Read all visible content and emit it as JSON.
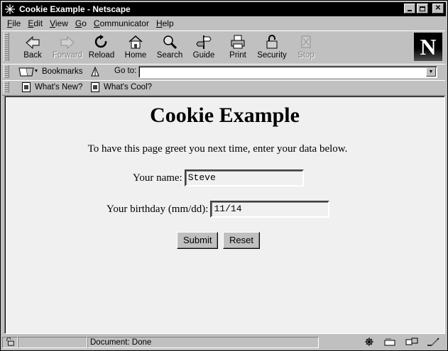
{
  "window": {
    "title": "Cookie Example - Netscape"
  },
  "menu": [
    {
      "pre": "",
      "u": "F",
      "post": "ile"
    },
    {
      "pre": "",
      "u": "E",
      "post": "dit"
    },
    {
      "pre": "",
      "u": "V",
      "post": "iew"
    },
    {
      "pre": "",
      "u": "G",
      "post": "o"
    },
    {
      "pre": "",
      "u": "C",
      "post": "ommunicator"
    },
    {
      "pre": "",
      "u": "H",
      "post": "elp"
    }
  ],
  "toolbar": {
    "back": "Back",
    "forward": "Forward",
    "reload": "Reload",
    "home": "Home",
    "search": "Search",
    "guide": "Guide",
    "print": "Print",
    "security": "Security",
    "stop": "Stop",
    "logo": "N"
  },
  "location": {
    "bookmarks": "Bookmarks",
    "goto_label": "Go to:",
    "url": ""
  },
  "personal": {
    "whats_new": "What's New?",
    "whats_cool": "What's Cool?"
  },
  "page": {
    "heading": "Cookie Example",
    "intro": "To have this page greet you next time, enter your data below.",
    "name_label": "Your name:",
    "name_value": "Steve",
    "birthday_label": "Your birthday (mm/dd):",
    "birthday_value": "11/14",
    "submit": "Submit",
    "reset": "Reset"
  },
  "status": {
    "text": "Document: Done"
  }
}
